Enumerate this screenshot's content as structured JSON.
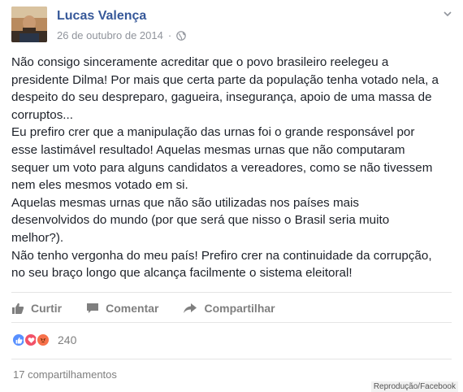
{
  "post": {
    "author": "Lucas Valença",
    "date": "26 de outubro de 2014",
    "dot": "·",
    "privacy_icon": "globe-icon",
    "menu_icon": "chevron-down-icon",
    "body_lines": [
      "Não consigo sinceramente acreditar que o povo brasileiro reelegeu a",
      "presidente Dilma! Por mais que certa parte da população tenha votado nela, a",
      "despeito do seu despreparo, gagueira, insegurança, apoio de uma massa de",
      "corruptos...",
      "Eu prefiro crer que a manipulação das urnas foi o grande responsável por",
      "esse lastimável resultado! Aquelas mesmas urnas que não computaram",
      "sequer um voto para alguns candidatos a vereadores, como se não tivessem",
      "nem eles mesmos votado em si.",
      "Aquelas mesmas urnas que não são utilizadas nos países mais",
      "desenvolvidos do mundo (por que será que nisso o Brasil seria muito",
      "melhor?).",
      "Não tenho vergonha do meu país! Prefiro crer na continuidade da corrupção,",
      "no seu braço longo que alcança facilmente o sistema eleitoral!"
    ]
  },
  "actions": {
    "like": "Curtir",
    "comment": "Comentar",
    "share": "Compartilhar"
  },
  "reactions": {
    "icons": [
      "like-icon",
      "love-icon",
      "angry-icon"
    ],
    "count": "240"
  },
  "shares": "17 compartilhamentos",
  "credit": "Reprodução/Facebook",
  "colors": {
    "author": "#365899",
    "text": "#1d2129",
    "muted": "#90949c",
    "like_blue": "#5890ff",
    "love_red": "#f25268",
    "angry_orange": "#f7714b"
  }
}
